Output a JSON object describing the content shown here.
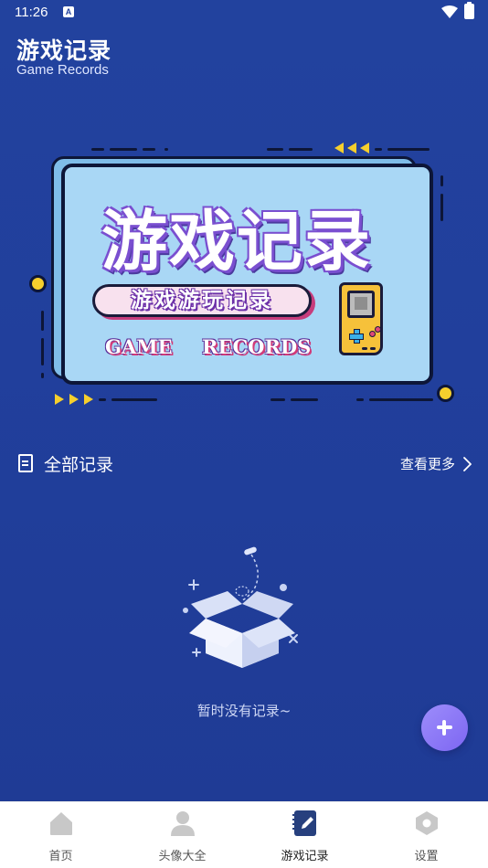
{
  "status_bar": {
    "time": "11:26",
    "notification_badge": "A"
  },
  "header": {
    "title": "游戏记录",
    "subtitle": "Game Records"
  },
  "banner": {
    "title": "游戏记录",
    "pill_text": "游戏游玩记录",
    "word_left": "GAME",
    "word_right": "RECORDS"
  },
  "section": {
    "title": "全部记录",
    "see_more": "查看更多"
  },
  "empty_state": {
    "text": "暂时没有记录~"
  },
  "fab": {
    "icon": "plus-icon"
  },
  "bottom_nav": {
    "items": [
      {
        "label": "首页",
        "icon": "home-icon",
        "active": false
      },
      {
        "label": "头像大全",
        "icon": "person-icon",
        "active": false
      },
      {
        "label": "游戏记录",
        "icon": "notebook-pen-icon",
        "active": true
      },
      {
        "label": "设置",
        "icon": "hexagon-settings-icon",
        "active": false
      }
    ]
  },
  "colors": {
    "background": "#213f9c",
    "accent_fab": "#8b78f6",
    "banner_blue": "#a9d7f5",
    "banner_yellow": "#f6cf2d",
    "nav_inactive_icon": "#c8c8c8",
    "nav_active_icon": "#27407e"
  }
}
